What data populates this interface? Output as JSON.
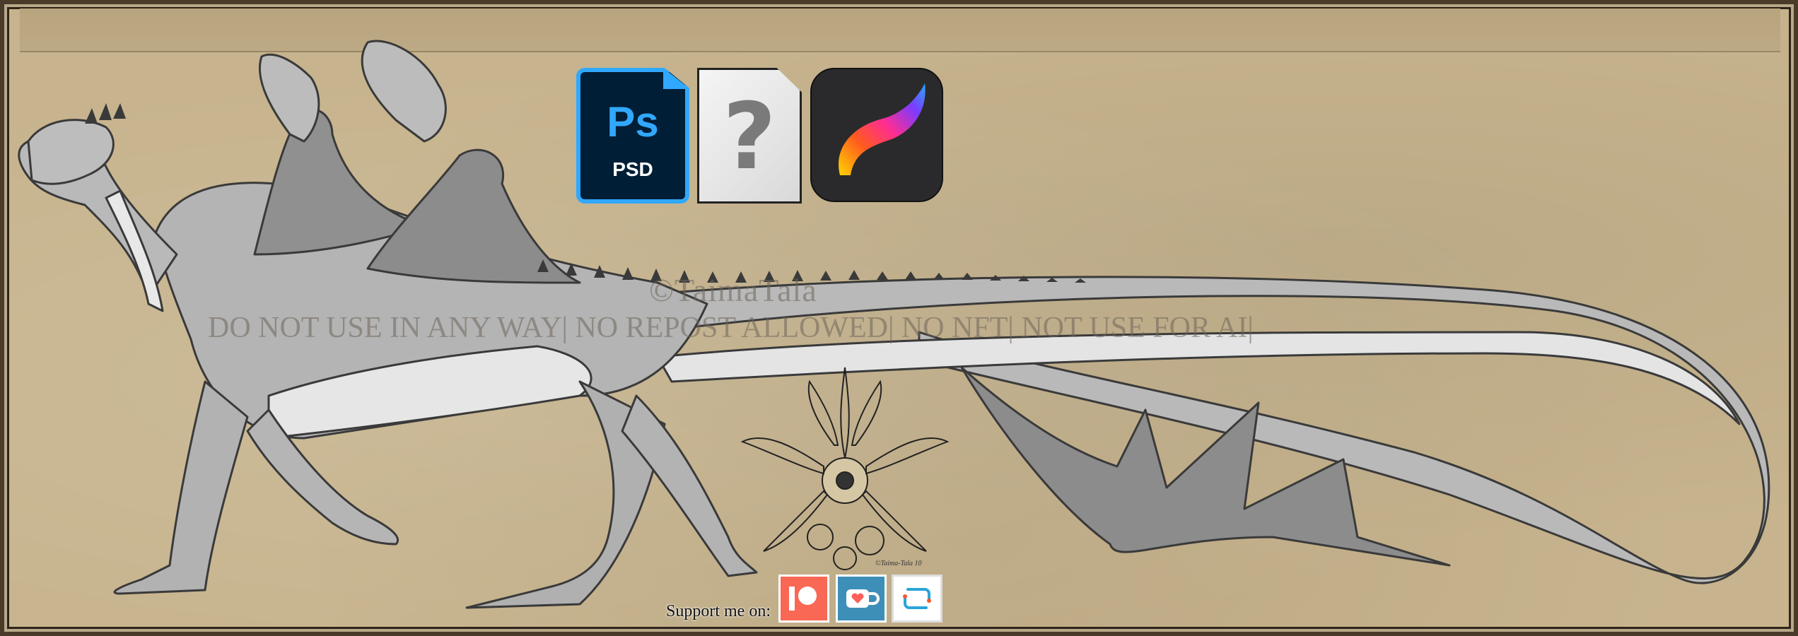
{
  "artwork": {
    "watermark_line1": "©TaimaTala",
    "watermark_line2": "DO NOT USE IN ANY WAY| NO REPOST ALLOWED| NO NFT| NOT USE FOR AI|",
    "signature": "©Taima-Tala 10"
  },
  "software_icons": [
    {
      "name": "photoshop-psd-icon",
      "label": "Ps",
      "sublabel": "PSD",
      "color": "#31a8ff"
    },
    {
      "name": "clip-studio-file-icon",
      "glyph": "?"
    },
    {
      "name": "procreate-icon"
    }
  ],
  "support": {
    "label": "Support me on:",
    "links": [
      {
        "name": "patreon-icon",
        "color": "#f96854"
      },
      {
        "name": "kofi-icon",
        "color": "#3e8fb8"
      },
      {
        "name": "linktree-icon",
        "color": "#ffffff"
      }
    ]
  },
  "colors": {
    "background_parchment": "#c7b48e",
    "frame_border": "#4a3a2a",
    "dragon_body": "#b4b4b4",
    "dragon_belly": "#e6e6e6",
    "dragon_wing_membrane": "#8c8c8c"
  }
}
